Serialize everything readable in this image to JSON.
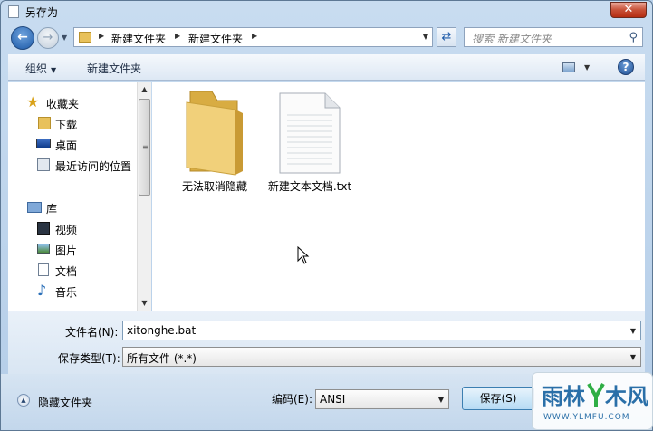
{
  "window": {
    "title": "另存为",
    "close_label": "✕"
  },
  "address_bar": {
    "segments": [
      "新建文件夹",
      "新建文件夹"
    ],
    "search_placeholder": "搜索 新建文件夹"
  },
  "toolbar": {
    "organize_label": "组织",
    "new_folder_label": "新建文件夹",
    "help_label": "?"
  },
  "nav": {
    "favorites_label": "收藏夹",
    "download_label": "下载",
    "desktop_label": "桌面",
    "recent_label": "最近访问的位置",
    "library_label": "库",
    "videos_label": "视频",
    "pictures_label": "图片",
    "documents_label": "文档",
    "music_label": "音乐"
  },
  "files": {
    "folder_label": "无法取消隐藏",
    "txt_label": "新建文本文档.txt"
  },
  "form": {
    "filename_label": "文件名(N):",
    "filename_value": "xitonghe.bat",
    "filetype_label": "保存类型(T):",
    "filetype_value": "所有文件  (*.*)",
    "encoding_label": "编码(E):",
    "encoding_value": "ANSI",
    "save_label": "保存(S)",
    "hide_folders_label": "隐藏文件夹"
  },
  "watermark": {
    "brand": "雨林木风",
    "url": "WWW.YLMFU.COM"
  },
  "colors": {
    "frame": "#b9d1ea",
    "toolbar": "#dde8f4",
    "close": "#c75037",
    "accent": "#1d5aa8"
  }
}
